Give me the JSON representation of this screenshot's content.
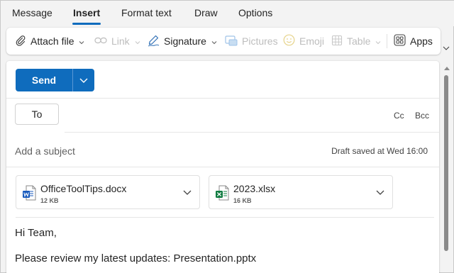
{
  "ribbon": {
    "tabs": [
      {
        "label": "Message"
      },
      {
        "label": "Insert"
      },
      {
        "label": "Format text"
      },
      {
        "label": "Draw"
      },
      {
        "label": "Options"
      }
    ],
    "active_tab": "Insert"
  },
  "toolbar": {
    "attach_file": "Attach file",
    "link": "Link",
    "signature": "Signature",
    "pictures": "Pictures",
    "emoji": "Emoji",
    "table": "Table",
    "apps": "Apps"
  },
  "compose": {
    "send_label": "Send",
    "to_label": "To",
    "to_value": "",
    "cc_label": "Cc",
    "bcc_label": "Bcc",
    "subject_placeholder": "Add a subject",
    "subject_value": "",
    "draft_status": "Draft saved at Wed 16:00",
    "attachments": [
      {
        "name": "OfficeToolTips.docx",
        "size": "12 KB",
        "icon": "word-file-icon"
      },
      {
        "name": "2023.xlsx",
        "size": "16 KB",
        "icon": "excel-file-icon"
      }
    ],
    "body_lines": [
      "Hi Team,",
      "Please review my latest updates: Presentation.pptx"
    ]
  },
  "colors": {
    "accent": "#0f6cbd",
    "word": "#185abd",
    "excel": "#107c41"
  }
}
